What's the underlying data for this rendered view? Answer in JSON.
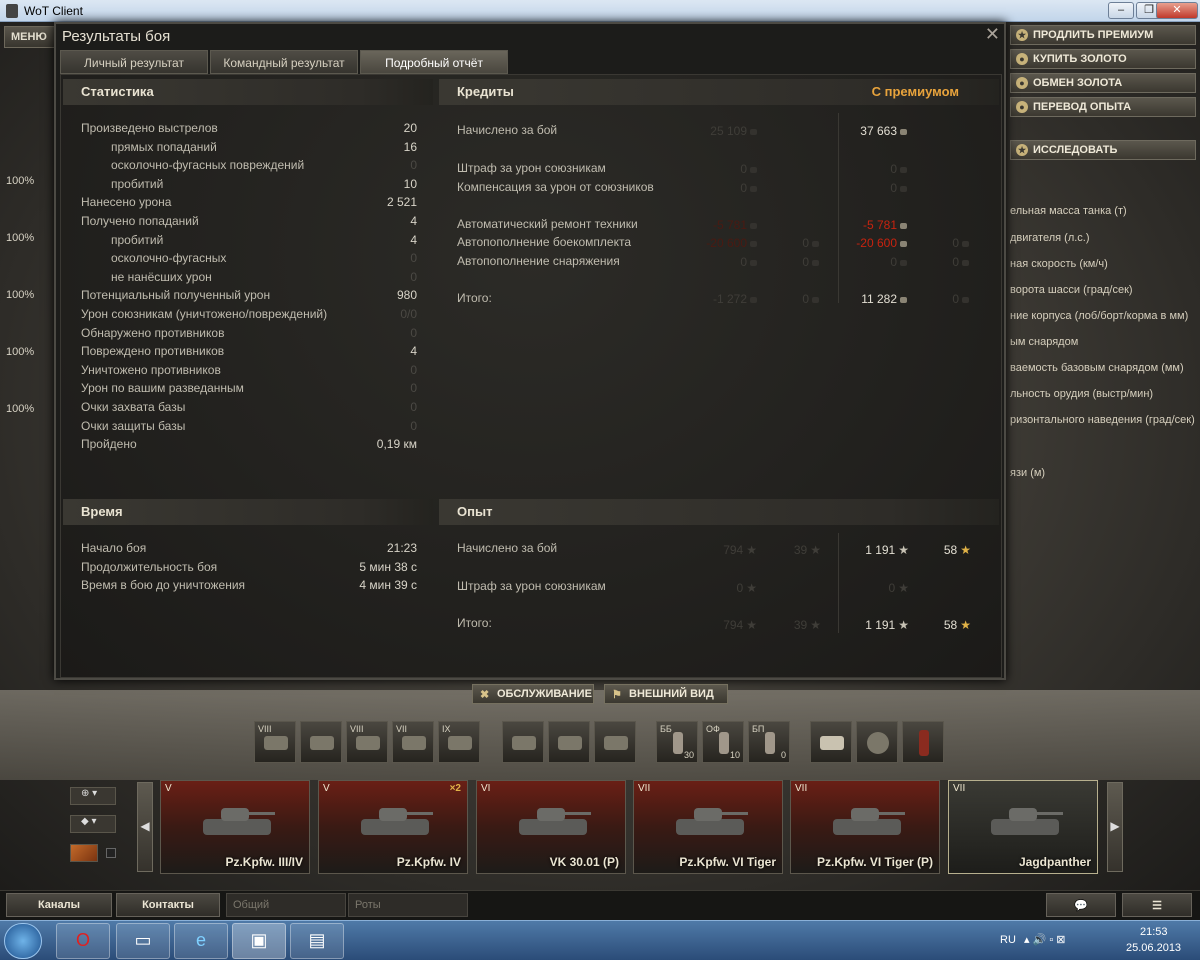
{
  "window": {
    "title": "WoT Client",
    "btn_min": "–",
    "btn_max": "❐",
    "btn_close": "✕"
  },
  "garage": {
    "menu_label": "МЕНЮ",
    "crew_pct": [
      "100%",
      "100%",
      "100%",
      "100%",
      "100%"
    ]
  },
  "right_menu": {
    "buttons": [
      "ПРОДЛИТЬ ПРЕМИУМ",
      "КУПИТЬ ЗОЛОТО",
      "ОБМЕН ЗОЛОТА",
      "ПЕРЕВОД ОПЫТА"
    ],
    "research": "ИССЛЕДОВАТЬ",
    "stats": [
      "ельная масса танка (т)",
      "двигателя (л.с.)",
      "ная скорость (км/ч)",
      "ворота шасси (град/сек)",
      "ние корпуса (лоб/борт/корма в мм)",
      "ым снарядом",
      "ваемость базовым снарядом (мм)",
      "льность орудия (выстр/мин)",
      "ризонтального наведения (град/сек)",
      "язи (м)"
    ]
  },
  "dialog": {
    "title": "Результаты боя",
    "close": "✕",
    "tabs": [
      "Личный результат",
      "Командный результат",
      "Подробный отчёт"
    ],
    "stats_header": "Статистика",
    "stats": [
      {
        "label": "Произведено выстрелов",
        "value": "20",
        "indent": false,
        "dim": false
      },
      {
        "label": "прямых попаданий",
        "value": "16",
        "indent": true,
        "dim": false
      },
      {
        "label": "осколочно-фугасных повреждений",
        "value": "0",
        "indent": true,
        "dim": true
      },
      {
        "label": "пробитий",
        "value": "10",
        "indent": true,
        "dim": false
      },
      {
        "label": "Нанесено урона",
        "value": "2 521",
        "indent": false,
        "dim": false
      },
      {
        "label": "Получено попаданий",
        "value": "4",
        "indent": false,
        "dim": false
      },
      {
        "label": "пробитий",
        "value": "4",
        "indent": true,
        "dim": false
      },
      {
        "label": "осколочно-фугасных",
        "value": "0",
        "indent": true,
        "dim": true
      },
      {
        "label": "не нанёсших урон",
        "value": "0",
        "indent": true,
        "dim": true
      },
      {
        "label": "Потенциальный полученный урон",
        "value": "980",
        "indent": false,
        "dim": false
      },
      {
        "label": "Урон союзникам (уничтожено/повреждений)",
        "value": "0/0",
        "indent": false,
        "dim": true
      },
      {
        "label": "Обнаружено противников",
        "value": "0",
        "indent": false,
        "dim": true
      },
      {
        "label": "Повреждено противников",
        "value": "4",
        "indent": false,
        "dim": false
      },
      {
        "label": "Уничтожено противников",
        "value": "0",
        "indent": false,
        "dim": true
      },
      {
        "label": "Урон по вашим разведанным",
        "value": "0",
        "indent": false,
        "dim": true
      },
      {
        "label": "Очки захвата базы",
        "value": "0",
        "indent": false,
        "dim": true
      },
      {
        "label": "Очки защиты базы",
        "value": "0",
        "indent": false,
        "dim": true
      },
      {
        "label": "Пройдено",
        "value": "0,19 км",
        "indent": false,
        "dim": false
      }
    ],
    "credits_header": "Кредиты",
    "premium_label": "С премиумом",
    "credits": [
      {
        "label": "Начислено за бой",
        "base": "25 109",
        "base_gold": "",
        "prem": "37 663",
        "prem_gold": "",
        "red": false
      },
      {
        "label": "Штраф за урон союзникам",
        "base": "0",
        "base_gold": "",
        "prem": "0",
        "prem_gold": "",
        "red": false
      },
      {
        "label": "Компенсация за урон от союзников",
        "base": "0",
        "base_gold": "",
        "prem": "0",
        "prem_gold": "",
        "red": false
      },
      {
        "label": "Автоматический ремонт техники",
        "base": "-5 781",
        "base_gold": "",
        "prem": "-5 781",
        "prem_gold": "",
        "red": true
      },
      {
        "label": "Автопополнение боекомплекта",
        "base": "-20 600",
        "base_gold": "0",
        "prem": "-20 600",
        "prem_gold": "0",
        "red": true
      },
      {
        "label": "Автопополнение снаряжения",
        "base": "0",
        "base_gold": "0",
        "prem": "0",
        "prem_gold": "0",
        "red": false
      },
      {
        "label": "Итого:",
        "base": "-1 272",
        "base_gold": "0",
        "prem": "11 282",
        "prem_gold": "0",
        "red": false
      }
    ],
    "time_header": "Время",
    "time": [
      {
        "label": "Начало боя",
        "value": "21:23"
      },
      {
        "label": "Продолжительность боя",
        "value": "5 мин 38 с"
      },
      {
        "label": "Время в бою до уничтожения",
        "value": "4 мин 39 с"
      }
    ],
    "exp_header": "Опыт",
    "exp": [
      {
        "label": "Начислено за бой",
        "base": "794",
        "base_free": "39",
        "prem": "1 191",
        "prem_free": "58"
      },
      {
        "label": "Штраф за урон союзникам",
        "base": "0",
        "base_free": "",
        "prem": "0",
        "prem_free": ""
      },
      {
        "label": "Итого:",
        "base": "794",
        "base_free": "39",
        "prem": "1 191",
        "prem_free": "58"
      }
    ]
  },
  "actions": {
    "service": "ОБСЛУЖИВАНИЕ",
    "appearance": "ВНЕШНИЙ ВИД"
  },
  "modules": [
    "VIII",
    "",
    "VIII",
    "VII",
    "IX"
  ],
  "ammo": [
    {
      "type": "ББ",
      "count": "30"
    },
    {
      "type": "ОФ",
      "count": "10"
    },
    {
      "type": "БП",
      "count": "0"
    }
  ],
  "tanks": [
    {
      "tier": "V",
      "name": "Pz.Kpfw. III/IV",
      "x2": ""
    },
    {
      "tier": "V",
      "name": "Pz.Kpfw. IV",
      "x2": "×2"
    },
    {
      "tier": "VI",
      "name": "VK 30.01 (P)",
      "x2": ""
    },
    {
      "tier": "VII",
      "name": "Pz.Kpfw. VI Tiger",
      "x2": ""
    },
    {
      "tier": "VII",
      "name": "Pz.Kpfw. VI Tiger (P)",
      "x2": ""
    },
    {
      "tier": "VII",
      "name": "Jagdpanther",
      "x2": ""
    }
  ],
  "chat": {
    "channels": "Каналы",
    "contacts": "Контакты",
    "general": "Общий",
    "companies": "Роты"
  },
  "taskbar": {
    "lang": "RU",
    "time": "21:53",
    "date": "25.06.2013"
  }
}
